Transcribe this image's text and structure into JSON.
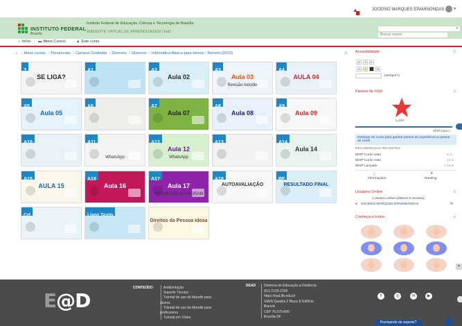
{
  "topbar": {
    "user_name": "JOCENIO MARQUES EPAMINONDAS",
    "caret": "▾"
  },
  "header": {
    "institution_short": "INSTITUTO FEDERAL",
    "institution_campus": "Brasília",
    "institution_full": "Instituto Federal de Educação, Ciência e Tecnologia de Brasília",
    "ava_name": "AMBIENTE VIRTUAL DE APRENDIZAGEM | EaD",
    "search_placeholder": "Buscar cursos",
    "brand_green": "#2f9e41",
    "brand_red": "#c62828"
  },
  "nav": {
    "items": [
      {
        "icon": "home-icon",
        "label": "Início"
      },
      {
        "icon": "courses-icon",
        "label": "Meus Cursos"
      },
      {
        "icon": "course-icon",
        "label": "Este curso"
      }
    ]
  },
  "breadcrumb": {
    "items": [
      "Meus cursos",
      "Presenciais",
      "Campus Ceilândia",
      "Diversos",
      "Diversos",
      "Informática Básica para Idosos - Remoto (2023)"
    ]
  },
  "tiles": [
    {
      "label": "?",
      "title": "SE LIGA?",
      "sub": "",
      "band": "#1e88c7",
      "bg": "#f5f5f5",
      "fg": "#222"
    },
    {
      "label": "A1",
      "title": "",
      "sub": "",
      "band": "#1e88c7",
      "bg": "#bfe3f5",
      "fg": "#333"
    },
    {
      "label": "A2",
      "title": "Aula 02",
      "sub": "",
      "band": "#1e88c7",
      "bg": "#d9eef7",
      "fg": "#2a2a2a"
    },
    {
      "label": "A3",
      "title": "Aula 03",
      "sub": "Revisão moodle",
      "band": "#1e88c7",
      "bg": "#eef4fb",
      "fg": "#e65100"
    },
    {
      "label": "A4",
      "title": "AULA 04",
      "sub": "",
      "band": "#1e88c7",
      "bg": "#e8f1f8",
      "fg": "#c62828"
    },
    {
      "label": "A5",
      "title": "Aula 05",
      "sub": "",
      "band": "#1e88c7",
      "bg": "#e3f2fb",
      "fg": "#1565c0"
    },
    {
      "label": "A6",
      "title": "",
      "sub": "",
      "band": "#1e88c7",
      "bg": "#f0eeea",
      "fg": "#333"
    },
    {
      "label": "A7",
      "title": "Aula 07",
      "sub": "",
      "band": "#1e88c7",
      "bg": "#7cb342",
      "fg": "#222"
    },
    {
      "label": "A8",
      "title": "Aula 08",
      "sub": "",
      "band": "#1e88c7",
      "bg": "#e8f0fb",
      "fg": "#1a237e"
    },
    {
      "label": "A9",
      "title": "Aula 09",
      "sub": "",
      "band": "#1e88c7",
      "bg": "#f7f7f7",
      "fg": "#c62828"
    },
    {
      "label": "A10",
      "title": "",
      "sub": "",
      "band": "#1e88c7",
      "bg": "#e7f1f7",
      "fg": "#333"
    },
    {
      "label": "A11",
      "title": "",
      "sub": "WhatsApp",
      "band": "#1e88c7",
      "bg": "#f4f4f4",
      "fg": "#333"
    },
    {
      "label": "A12",
      "title": "Aula 12",
      "sub": "WhatsApp",
      "band": "#1e88c7",
      "bg": "#d6f0d0",
      "fg": "#6a1b9a"
    },
    {
      "label": "A13",
      "title": "",
      "sub": "",
      "band": "#1e88c7",
      "bg": "#f2f2f2",
      "fg": "#c62828"
    },
    {
      "label": "A14",
      "title": "Aula 14",
      "sub": "",
      "band": "#1e88c7",
      "bg": "#eaf3ee",
      "fg": "#333"
    },
    {
      "label": "A15",
      "title": "AULA 15",
      "sub": "",
      "band": "#1e88c7",
      "bg": "#fbf7ea",
      "fg": "#1565c0"
    },
    {
      "label": "A16",
      "title": "Aula 16",
      "sub": "",
      "band": "#1e88c7",
      "bg": "#c2185b",
      "fg": "#ffffff"
    },
    {
      "label": "A17",
      "title": "Aula 17",
      "sub": "RECURSOS INSTAGRAM",
      "band": "#1e88c7",
      "bg": "#8e24aa",
      "fg": "#ffffff"
    },
    {
      "label": "A18",
      "title": "AUTOAVALIAÇÃO",
      "sub": "",
      "band": "#1e88c7",
      "bg": "#f7f7f7",
      "fg": "#333"
    },
    {
      "label": "RF",
      "title": "RESULTADO FINAL",
      "sub": "",
      "band": "#1e88c7",
      "bg": "#dceff9",
      "fg": "#0d47a1"
    },
    {
      "label": "Crt",
      "title": "",
      "sub": "",
      "band": "#1e88c7",
      "bg": "#eaf3fa",
      "fg": "#333"
    },
    {
      "label": "Livro Texto",
      "title": "",
      "sub": "",
      "band": "#1e88c7",
      "bg": "#c7e6f4",
      "fg": "#333"
    },
    {
      "label": "",
      "title": "Direitos da Pessoa Idosa",
      "sub": "",
      "band": "#ffffff",
      "bg": "#fff8e1",
      "fg": "#6d4c41"
    }
  ],
  "sidebar": {
    "accessibility": {
      "title": "Acessibilidade",
      "font_buttons": [
        "A",
        "A",
        "A-"
      ],
      "contrast_buttons": [
        "A",
        "A",
        "A",
        "A"
      ],
      "save_label": "(sempre?)"
    },
    "gamification": {
      "title": "Passou de nível",
      "points": "1.230",
      "next_level": "40XP para o"
    },
    "rewards": {
      "prompt": "Participe do curso para ganhar pontos de experiência e passar de nível!",
      "heading": "RECOMPENSAS RECENTES",
      "items": [
        {
          "label": "50XP Curso visto",
          "time": "6 m"
        },
        {
          "label": "50XP Curso visto",
          "time": "12 m"
        },
        {
          "label": "50XP Lançado",
          "time": "1 hora"
        }
      ],
      "info_label": "Informações",
      "ranking_label": "Ranking"
    },
    "online": {
      "title": "Usuários Online",
      "count_text": "1 usuário online (últimos 5 minutos)",
      "user": "JOCENIO MARQUES EPAMINONDAS"
    },
    "team": {
      "title": "Conheça a turma"
    }
  },
  "footer": {
    "logo_a": "E",
    "logo_b": "@D",
    "conteudo_label": "CONTEÚDO",
    "conteudo_links": [
      "Ambientação",
      "Suporte Técnico",
      "Tutorial de uso do Moodle para",
      "alunos",
      "Tutorial de uso do Moodle para",
      "professores",
      "Tutorial em Vídeo"
    ],
    "ead_label": "DEAD",
    "ead_lines": [
      "Diretoria de Educação a Distância",
      "(61) 2103-2159",
      "https://ead.ifb.edu.br",
      "SIA/N Quadra 2 Bloco E Edifício",
      "Bianchi",
      "CEP 70.070-600",
      "Brasília-DF"
    ],
    "social": [
      "f",
      "◎",
      "✉",
      "▶"
    ]
  },
  "support": {
    "label": "Precisando de suporte?",
    "close": "✕"
  }
}
